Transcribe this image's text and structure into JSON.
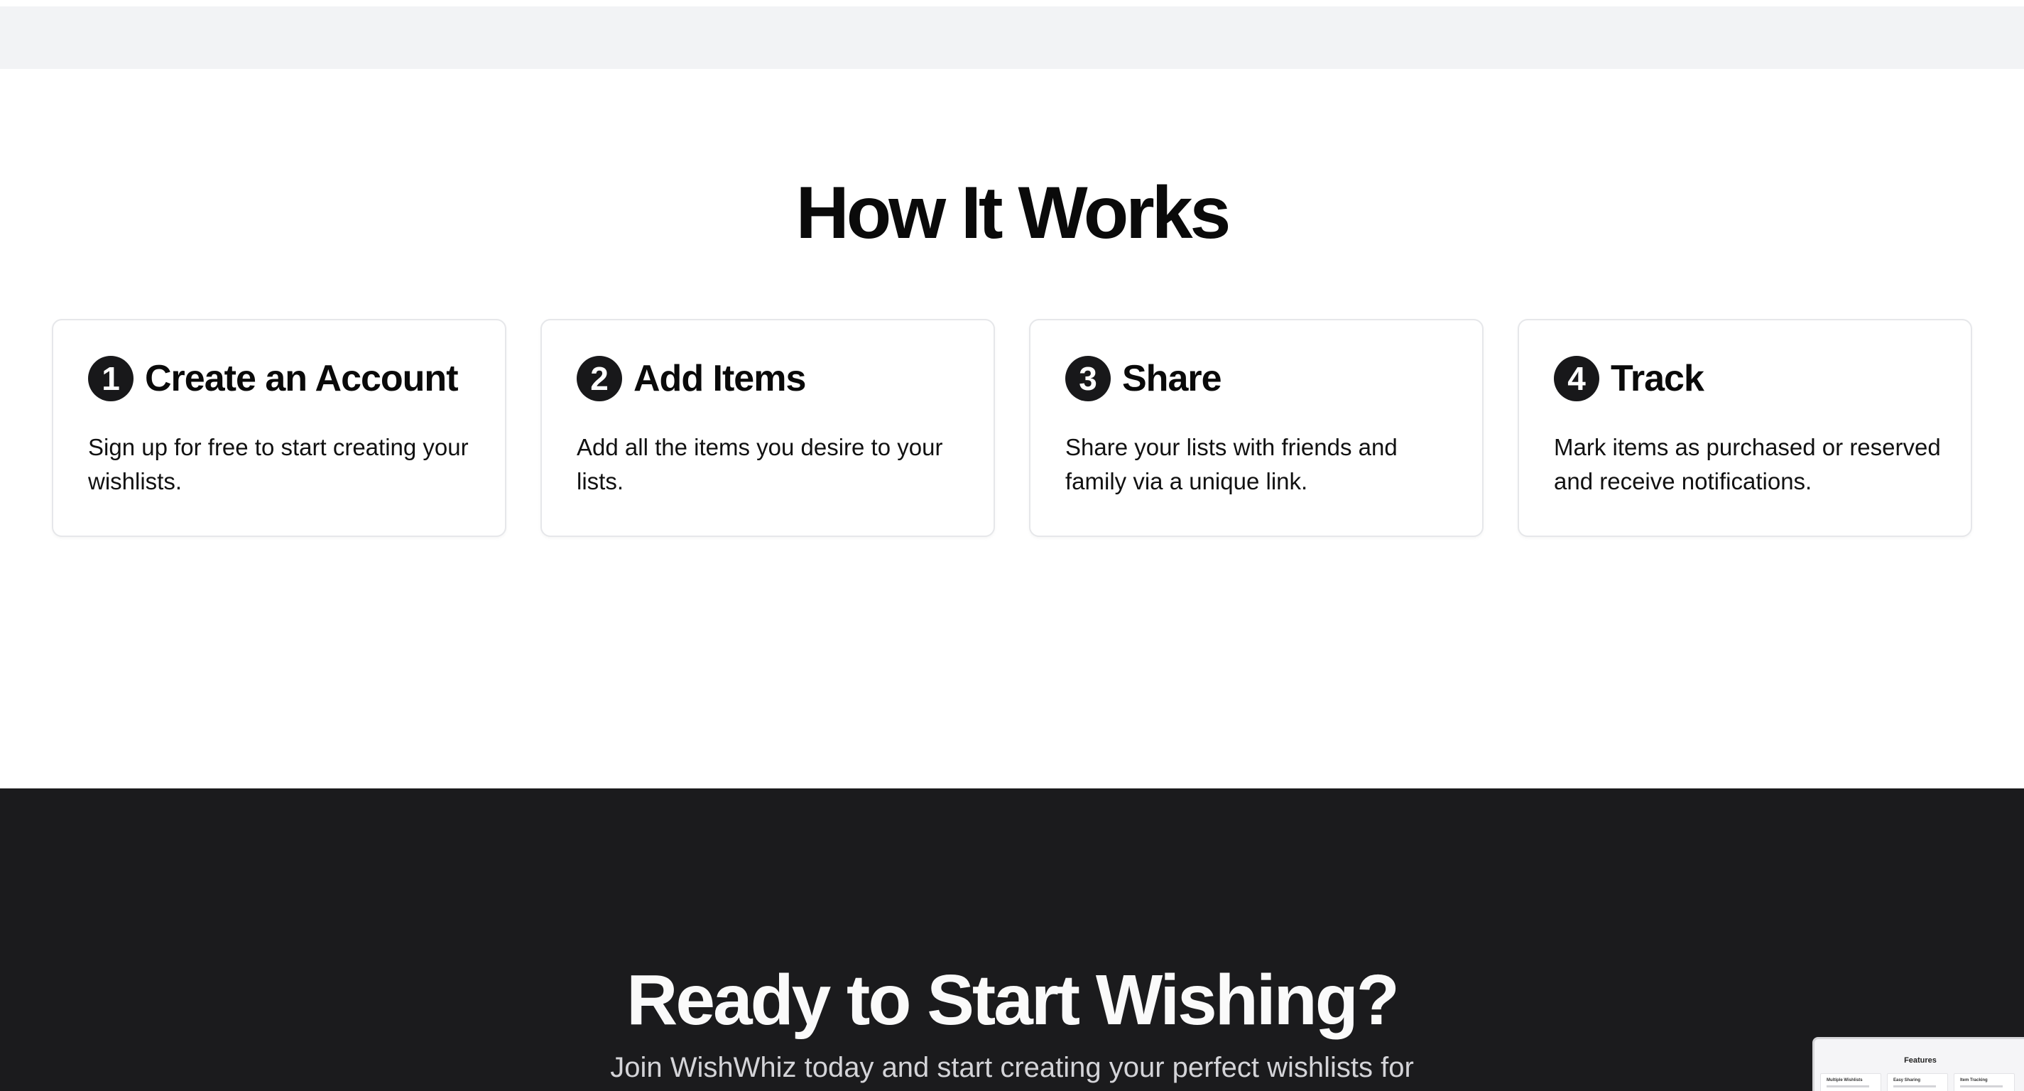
{
  "how_it_works": {
    "title": "How It Works",
    "steps": [
      {
        "number": "1",
        "title": "Create an Account",
        "description": "Sign up for free to start creating your wishlists."
      },
      {
        "number": "2",
        "title": "Add Items",
        "description": "Add all the items you desire to your lists."
      },
      {
        "number": "3",
        "title": "Share",
        "description": "Share your lists with friends and family via a unique link."
      },
      {
        "number": "4",
        "title": "Track",
        "description": "Mark items as purchased or reserved and receive notifications."
      }
    ]
  },
  "cta": {
    "title": "Ready to Start Wishing?",
    "subtitle": "Join WishWhiz today and start creating your perfect wishlists for"
  },
  "preview": {
    "title": "Features",
    "cards": [
      "Multiple Wishlists",
      "Easy Sharing",
      "Item Tracking"
    ]
  },
  "colors": {
    "dark_section": "#1b1b1d",
    "top_strip": "#f2f3f5",
    "badge": "#18181a"
  }
}
